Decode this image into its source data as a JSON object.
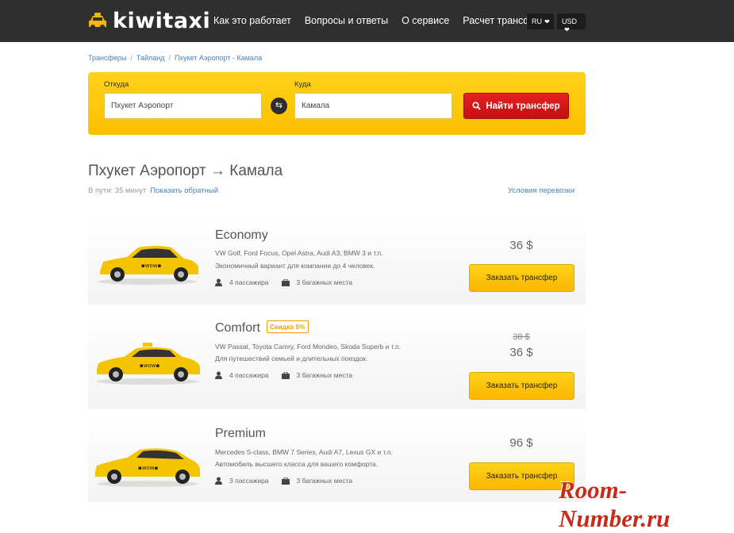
{
  "header": {
    "logo": "kiwitaxi",
    "nav": [
      "Как это работает",
      "Вопросы и ответы",
      "О сервисе",
      "Расчет трансфера"
    ],
    "lang": "RU",
    "currency": "USD"
  },
  "breadcrumb": [
    "Трансферы",
    "Тайланд",
    "Пхукет Аэропорт - Камала"
  ],
  "search": {
    "from_label": "Откуда",
    "from_value": "Пхукет Аэропорт",
    "to_label": "Куда",
    "to_value": "Камала",
    "button": "Найти трансфер"
  },
  "route": {
    "title": "Пхукет Аэропорт → Камала",
    "duration": "В пути: 35 минут",
    "reverse_link": "Показать обратный",
    "terms_link": "Условия перевозки"
  },
  "cards": [
    {
      "class": "Economy",
      "models": "VW Golf, Ford Focus, Opel Astra, Audi A3, BMW 3 и т.п.",
      "desc": "Экономичный вариант для компании до 4 человек.",
      "passengers": "4 пассажира",
      "luggage": "3 багажных места",
      "price": "36 $",
      "button": "Заказать трансфер",
      "car_color": "#f5c400"
    },
    {
      "class": "Comfort",
      "badge": "Скидка 5%",
      "models": "VW Passat, Toyota Camry, Ford Mondeo, Skoda Superb и т.п.",
      "desc": "Для путешествий семьей и длительных поездок.",
      "passengers": "4 пассажира",
      "luggage": "3 багажных места",
      "old_price": "38 $",
      "price": "36 $",
      "button": "Заказать трансфер",
      "car_color": "#f5c400"
    },
    {
      "class": "Premium",
      "models": "Mercedes S-class, BMW 7 Series, Audi A7, Lexus GX и т.п.",
      "desc": "Автомобиль высшего класса для вашего комфорта.",
      "passengers": "3 пассажира",
      "luggage": "3 багажных места",
      "price": "96 $",
      "button": "Заказать трансфер",
      "car_color": "#f5c400"
    }
  ],
  "watermark": "Room-Number.ru",
  "colors": {
    "header_bg": "#2f2f2f",
    "accent_yellow": "#fdc500",
    "search_button": "#d41818",
    "link": "#4a7fb5"
  }
}
